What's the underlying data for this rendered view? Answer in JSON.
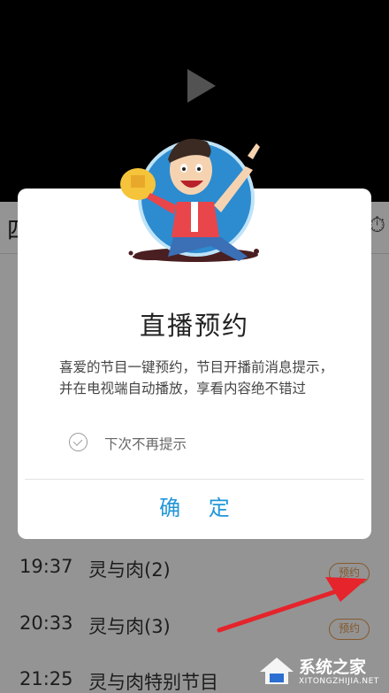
{
  "header": {
    "left_text": "四",
    "right_icon": "clock-icon"
  },
  "programs": [
    {
      "time": "19:37",
      "title": "灵与肉(2)",
      "badge": "预约"
    },
    {
      "time": "20:33",
      "title": "灵与肉(3)",
      "badge": "预约"
    },
    {
      "time": "21:25",
      "title": "灵与肉特别节目",
      "badge": ""
    }
  ],
  "modal": {
    "title": "直播预约",
    "description": "喜爱的节目一键预约，节目开播前消息提示，并在电视端自动播放，享看内容绝不错过",
    "checkbox_label": "下次不再提示",
    "confirm_label": "确 定"
  },
  "watermark": {
    "text_cn": "系统之家",
    "text_en": "XITONGZHIJIA.NET"
  },
  "colors": {
    "accent": "#2196d9",
    "badge": "#e69a4f",
    "arrow": "#e5242b"
  }
}
